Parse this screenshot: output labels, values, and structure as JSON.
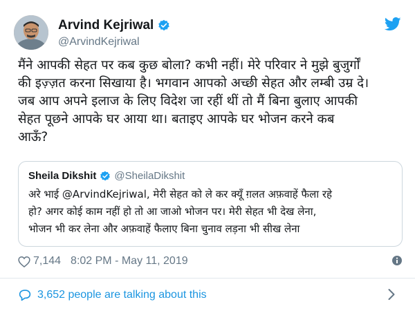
{
  "tweet": {
    "author_name": "Arvind Kejriwal",
    "author_handle": "@ArvindKejriwal",
    "text_lines": [
      "मैंने आपकी सेहत पर कब कुछ बोला? कभी नहीं। मेरे परिवार ने मुझे बुजुर्गों",
      "की इज़्ज़त करना सिखाया है। भगवान आपको अच्छी सेहत और लम्बी उम्र दे।",
      "जब आप अपने इलाज के लिए विदेश जा रहीं थीं तो मैं बिना बुलाए आपकी",
      "सेहत पूछने आपके घर आया था। बताइए आपके घर भोजन करने कब",
      "आऊँ?"
    ],
    "likes": "7,144",
    "timestamp": "8:02 PM - May 11, 2019"
  },
  "quoted": {
    "author_name": "Sheila Dikshit",
    "author_handle": "@SheilaDikshit",
    "text_lines": [
      "अरे भाई @ArvindKejriwal, मेरी सेहत को ले कर क्यूँ ग़लत अफ़वाहें फैला रहे",
      "हो? अगर कोई काम नहीं हो तो आ जाओ भोजन पर। मेरी सेहत भी देख लेना,",
      "भोजन भी कर लेना और अफ़वाहें फैलाए बिना चुनाव लड़ना भी सीख लेना"
    ]
  },
  "footer": {
    "talking_text": "3,652 people are talking about this"
  },
  "icons": {
    "verified": "verified-badge-icon",
    "twitter": "twitter-bird-icon",
    "heart": "heart-icon",
    "info": "info-icon",
    "bubble": "speech-bubble-icon",
    "chevron": "chevron-right-icon"
  },
  "colors": {
    "accent": "#1da1f2",
    "link": "#1b95e0",
    "muted": "#657786",
    "border": "#ccd6dd"
  }
}
